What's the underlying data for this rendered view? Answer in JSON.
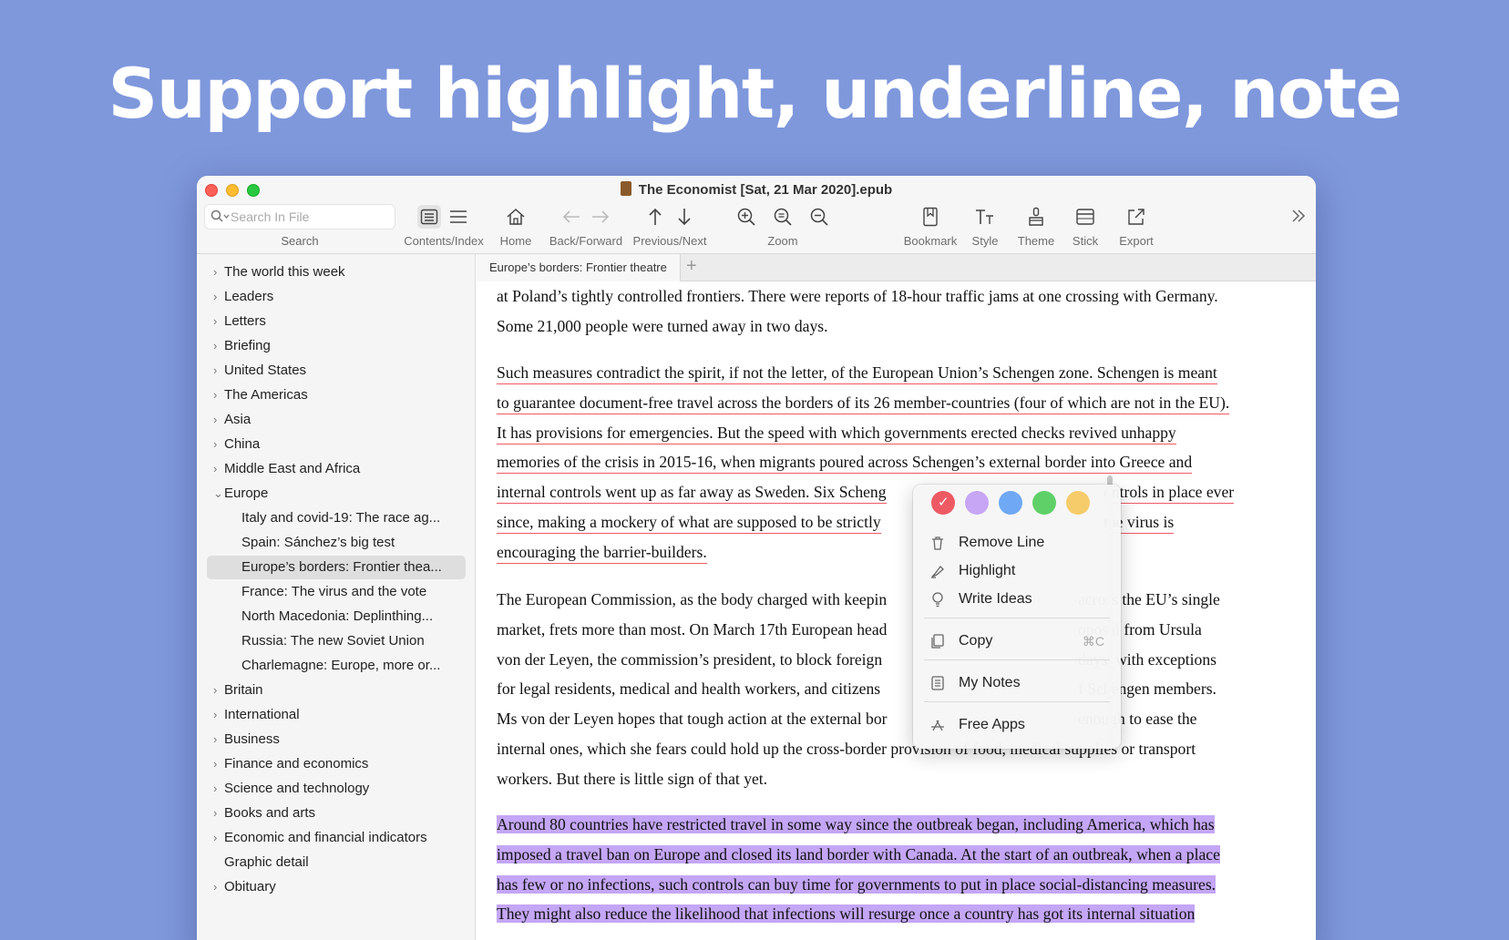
{
  "headline": "Support highlight, underline, note",
  "window": {
    "title": "The Economist [Sat, 21 Mar 2020].epub"
  },
  "search": {
    "placeholder": "Search In File",
    "label": "Search"
  },
  "toolbar": {
    "contents_label": "Contents/Index",
    "home_label": "Home",
    "backforward_label": "Back/Forward",
    "prevnext_label": "Previous/Next",
    "zoom_label": "Zoom",
    "bookmark_label": "Bookmark",
    "style_label": "Style",
    "theme_label": "Theme",
    "stick_label": "Stick",
    "export_label": "Export"
  },
  "sidebar": {
    "items": [
      "The world this week",
      "Leaders",
      "Letters",
      "Briefing",
      "United States",
      "The Americas",
      "Asia",
      "China",
      "Middle East and Africa",
      "Europe",
      "Italy and covid-19: The race ag...",
      "Spain: Sánchez’s big test",
      "Europe’s borders: Frontier thea...",
      "France: The virus and the vote",
      "North Macedonia: Deplinthing...",
      "Russia: The new Soviet Union",
      "Charlemagne: Europe, more or...",
      "Britain",
      "International",
      "Business",
      "Finance and economics",
      "Science and technology",
      "Books and arts",
      "Economic and financial indicators",
      "Graphic detail",
      "Obituary"
    ]
  },
  "tab": {
    "label": "Europe’s borders: Frontier theatre",
    "add": "+"
  },
  "article": {
    "p1": [
      "at Poland’s tightly controlled frontiers. There were reports of 18-hour traffic jams at one crossing with Germany.",
      "Some 21,000 people were turned away in two days."
    ],
    "p2": [
      "Such measures contradict the spirit, if not the letter, of the European Union’s Schengen zone. Schengen is meant",
      "to guarantee document-free travel across the borders of its 26 member-countries (four of which are not in the EU).",
      "It has provisions for emergencies. But the speed with which governments erected checks revived unhappy",
      "memories of the crisis in 2015-16, when migrants poured across Schengen’s external border into Greece and",
      "internal controls went up as far away as Sweden. Six Scheng",
      "since, making a mockery of what are supposed to be strictly",
      "encouraging the barrier-builders."
    ],
    "p2_right": [
      "ontrols in place ever",
      "the virus is"
    ],
    "p3": [
      "The European Commission, as the body charged with keepin",
      "market, frets more than most. On March 17th European head",
      "von der Leyen, the commission’s president, to block foreign",
      "for legal residents, medical and health workers, and citizens",
      "Ms von der Leyen hopes that tough action at the external bor",
      "internal ones, which she fears could hold up the cross-border provision of food, medical supplies or transport",
      "workers. But there is little sign of that yet."
    ],
    "p3_right": [
      "across the EU’s single",
      "oposal from Ursula",
      "days, with exceptions",
      "f Schengen members.",
      "enough to ease the"
    ],
    "p4": [
      "Around 80 countries have restricted travel in some way since the outbreak began, including America, which has",
      "imposed a travel ban on Europe and closed its land border with Canada. At the start of an outbreak, when a place",
      "has few or no infections, such controls can buy time for governments to put in place social-distancing measures.",
      "They might also reduce the likelihood that infections will resurge once a country has got its internal situation"
    ]
  },
  "context_menu": {
    "swatch_colors": [
      "#ee5a63",
      "#c7a6f5",
      "#6fa8f5",
      "#5fd068",
      "#f6cc6a"
    ],
    "remove_line": "Remove Line",
    "highlight": "Highlight",
    "write_ideas": "Write Ideas",
    "copy": "Copy",
    "copy_shortcut": "⌘C",
    "my_notes": "My Notes",
    "free_apps": "Free Apps"
  },
  "colors": {
    "background": "#7f98dc",
    "underline": "#ee5a63",
    "highlight_purple": "#c4a6f6"
  }
}
